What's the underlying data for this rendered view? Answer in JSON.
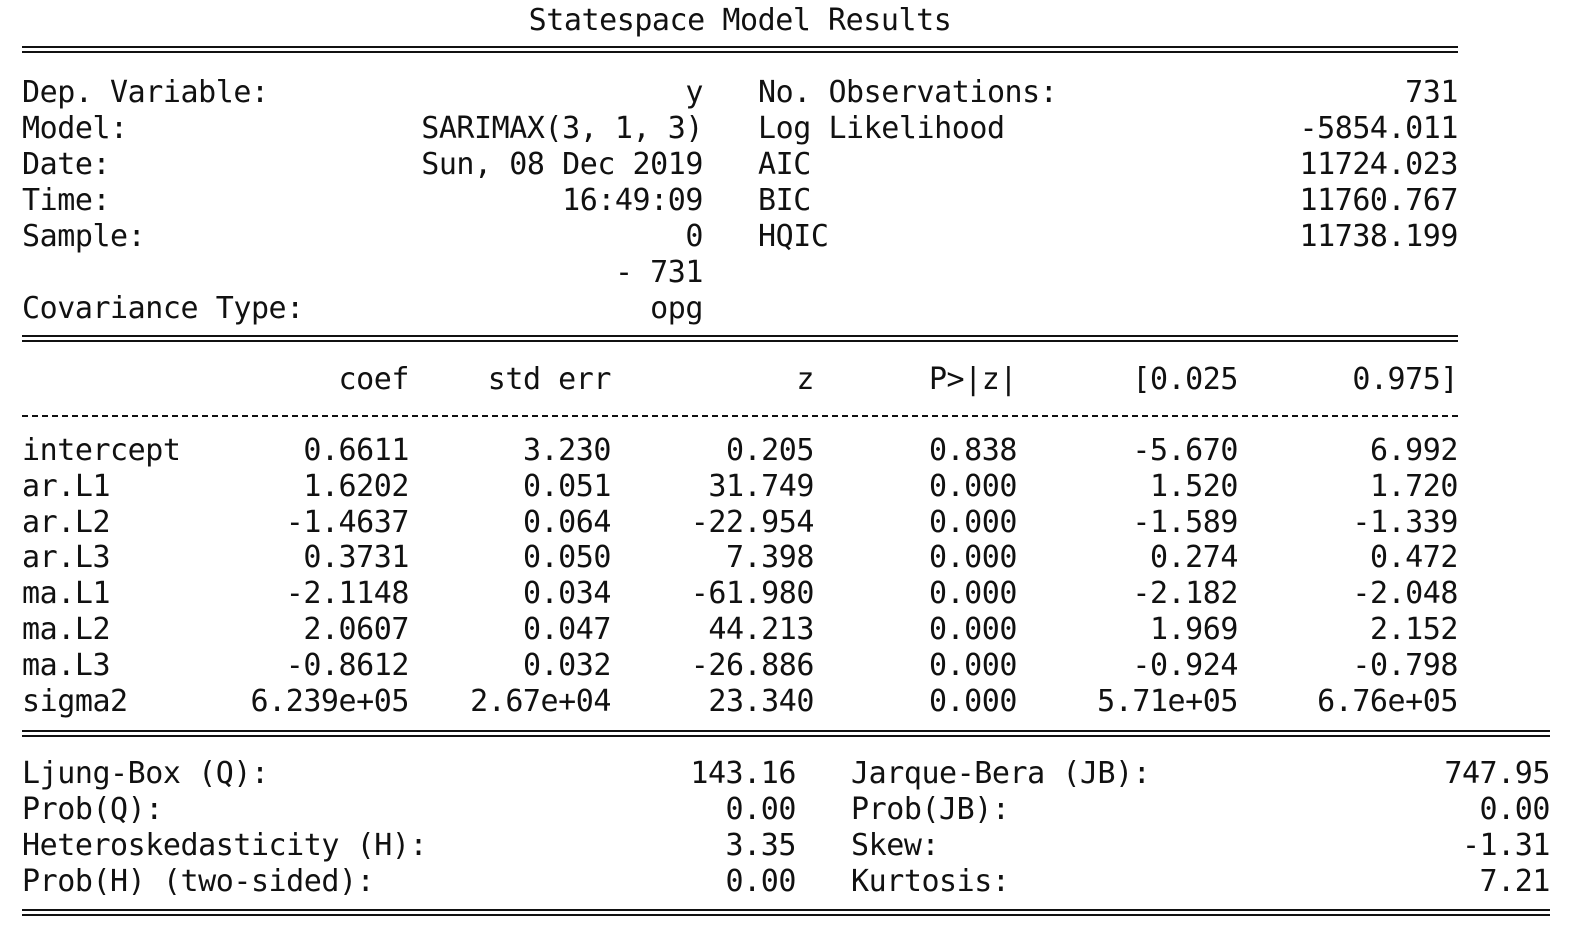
{
  "title": "Statespace Model Results",
  "header": {
    "left": [
      {
        "label": "Dep. Variable:",
        "value": "y"
      },
      {
        "label": "Model:",
        "value": "SARIMAX(3, 1, 3)"
      },
      {
        "label": "Date:",
        "value": "Sun, 08 Dec 2019"
      },
      {
        "label": "Time:",
        "value": "16:49:09"
      },
      {
        "label": "Sample:",
        "value": "0"
      },
      {
        "label": "",
        "value": "- 731"
      },
      {
        "label": "Covariance Type:",
        "value": "opg"
      }
    ],
    "right": [
      {
        "label": "No. Observations:",
        "value": "731"
      },
      {
        "label": "Log Likelihood",
        "value": "-5854.011"
      },
      {
        "label": "AIC",
        "value": "11724.023"
      },
      {
        "label": "BIC",
        "value": "11760.767"
      },
      {
        "label": "HQIC",
        "value": "11738.199"
      }
    ]
  },
  "coef_table": {
    "columns": [
      "coef",
      "std err",
      "z",
      "P>|z|",
      "[0.025",
      "0.975]"
    ],
    "rows": [
      {
        "name": "intercept",
        "cells": [
          "0.6611",
          "3.230",
          "0.205",
          "0.838",
          "-5.670",
          "6.992"
        ]
      },
      {
        "name": "ar.L1",
        "cells": [
          "1.6202",
          "0.051",
          "31.749",
          "0.000",
          "1.520",
          "1.720"
        ]
      },
      {
        "name": "ar.L2",
        "cells": [
          "-1.4637",
          "0.064",
          "-22.954",
          "0.000",
          "-1.589",
          "-1.339"
        ]
      },
      {
        "name": "ar.L3",
        "cells": [
          "0.3731",
          "0.050",
          "7.398",
          "0.000",
          "0.274",
          "0.472"
        ]
      },
      {
        "name": "ma.L1",
        "cells": [
          "-2.1148",
          "0.034",
          "-61.980",
          "0.000",
          "-2.182",
          "-2.048"
        ]
      },
      {
        "name": "ma.L2",
        "cells": [
          "2.0607",
          "0.047",
          "44.213",
          "0.000",
          "1.969",
          "2.152"
        ]
      },
      {
        "name": "ma.L3",
        "cells": [
          "-0.8612",
          "0.032",
          "-26.886",
          "0.000",
          "-0.924",
          "-0.798"
        ]
      },
      {
        "name": "sigma2",
        "cells": [
          "6.239e+05",
          "2.67e+04",
          "23.340",
          "0.000",
          "5.71e+05",
          "6.76e+05"
        ]
      }
    ]
  },
  "diagnostics": {
    "left": [
      {
        "label": "Ljung-Box (Q):",
        "value": "143.16"
      },
      {
        "label": "Prob(Q):",
        "value": "0.00"
      },
      {
        "label": "Heteroskedasticity (H):",
        "value": "3.35"
      },
      {
        "label": "Prob(H) (two-sided):",
        "value": "0.00"
      }
    ],
    "right": [
      {
        "label": "Jarque-Bera (JB):",
        "value": "747.95"
      },
      {
        "label": "Prob(JB):",
        "value": "0.00"
      },
      {
        "label": "Skew:",
        "value": "-1.31"
      },
      {
        "label": "Kurtosis:",
        "value": "7.21"
      }
    ]
  }
}
